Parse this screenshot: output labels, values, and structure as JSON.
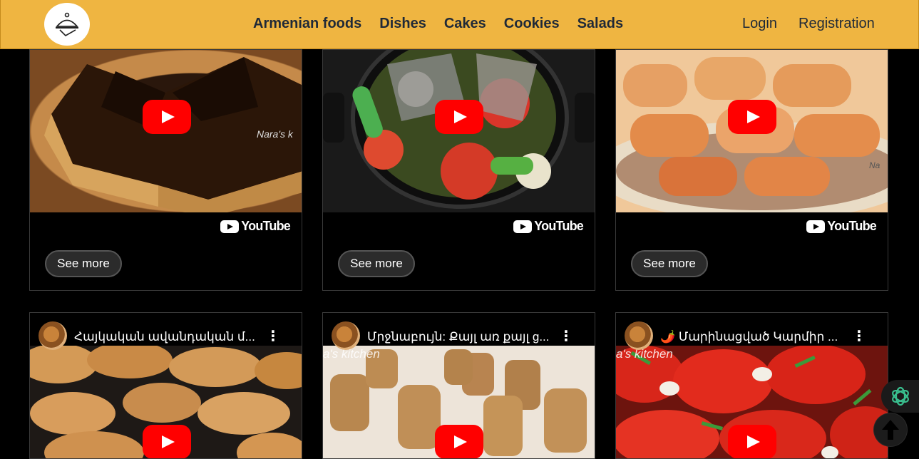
{
  "nav": {
    "links": [
      "Armenian foods",
      "Dishes",
      "Cakes",
      "Cookies",
      "Salads"
    ],
    "login": "Login",
    "registration": "Registration"
  },
  "cards_top": [
    {
      "subject": "layered chocolate cake",
      "brand": "YouTube",
      "button": "See more",
      "watermark": "Nara's k"
    },
    {
      "subject": "baked fish with vegetables",
      "brand": "YouTube",
      "button": "See more"
    },
    {
      "subject": "stuffed cabbage rolls",
      "brand": "YouTube",
      "button": "See more",
      "watermark": "Na"
    }
  ],
  "cards_bottom": [
    {
      "title": "Հայկական ավանդական մ...",
      "watermark": ""
    },
    {
      "title": "Մրջնաբույն: Քայլ առ քայլ g...",
      "watermark": "a's kitchen"
    },
    {
      "title": "🌶️ Մարինացված Կարմիր ...",
      "watermark": "a's kitchen"
    }
  ],
  "colors": {
    "navbar": "#efb541",
    "youtube_red": "#ff0000",
    "background": "#000000"
  },
  "icons": [
    "logo-chef-cloche-icon",
    "play-icon",
    "youtube-logo-icon",
    "kebab-menu-icon",
    "chatgpt-icon",
    "arrow-up-icon"
  ]
}
